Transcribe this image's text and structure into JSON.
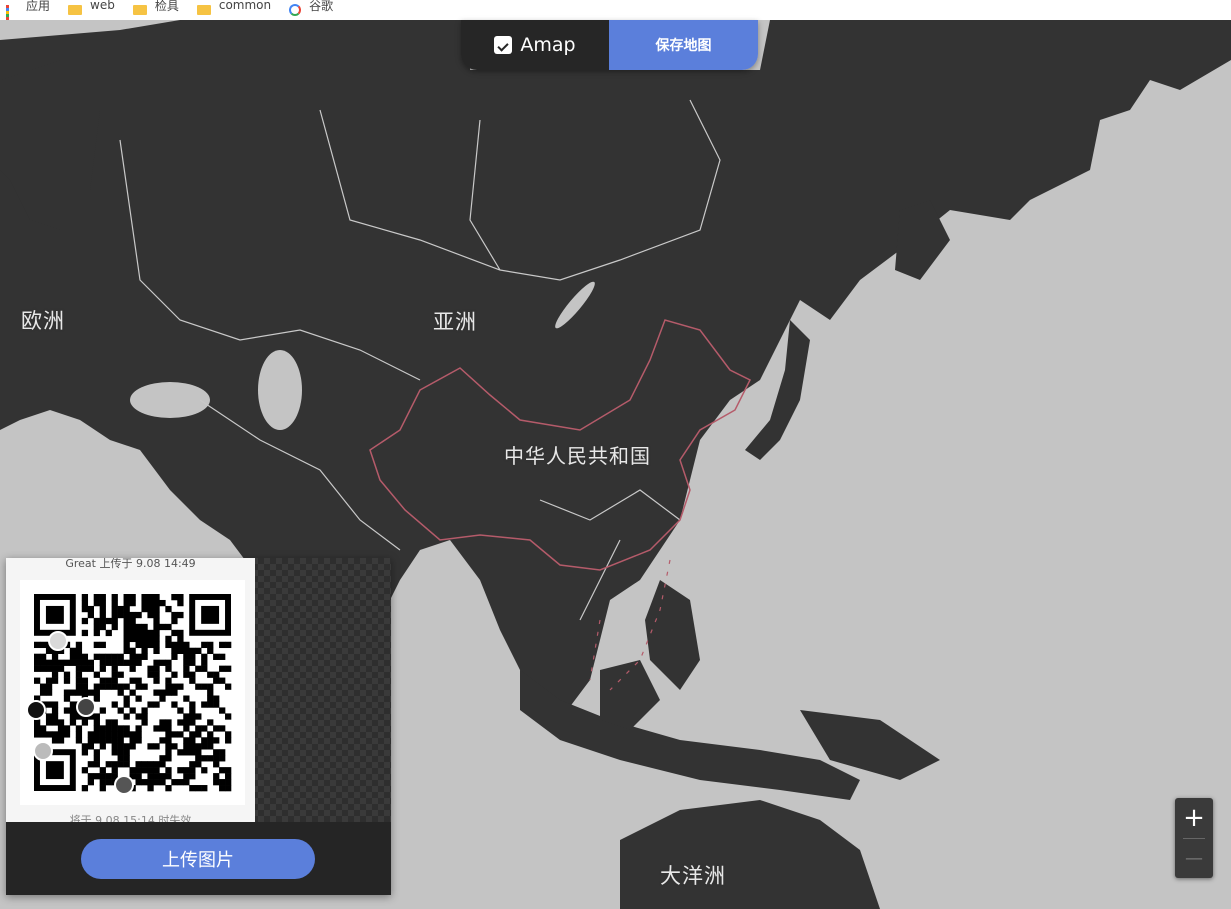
{
  "bookmarks": [
    {
      "label": "应用",
      "icon": "apps-grid-icon"
    },
    {
      "label": "web",
      "icon": "folder-icon"
    },
    {
      "label": "检具",
      "icon": "folder-icon"
    },
    {
      "label": "common",
      "icon": "folder-icon"
    },
    {
      "label": "谷歌",
      "icon": "google-icon"
    }
  ],
  "topbar": {
    "brand": "Amap",
    "brand_icon": "amap-logo-icon",
    "save_label": "保存地图"
  },
  "map": {
    "labels": {
      "europe": "欧洲",
      "asia": "亚洲",
      "china": "中华人民共和国",
      "oceania": "大洋洲"
    },
    "colors": {
      "land": "#333333",
      "water": "#c4c4c4",
      "border": "#c9c9c9",
      "china_border": "#b55b6a"
    }
  },
  "upload_panel": {
    "qr_caption": "Great 上传于 9.08 14:49",
    "qr_expire": "将于 9.08 15:14 时失效",
    "upload_label": "上传图片"
  },
  "zoom": {
    "in_label": "+",
    "out_label": "—"
  }
}
